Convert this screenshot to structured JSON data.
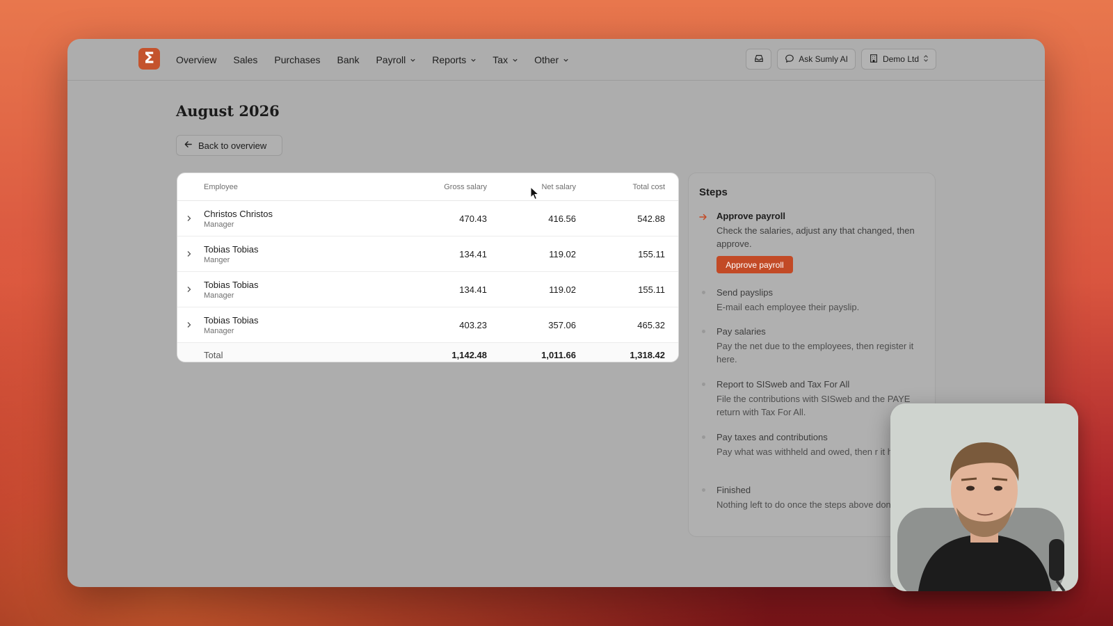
{
  "app": {
    "logo_glyph": "Σ",
    "accent": "#c4532d"
  },
  "nav": {
    "items": [
      {
        "label": "Overview",
        "dropdown": false
      },
      {
        "label": "Sales",
        "dropdown": false
      },
      {
        "label": "Purchases",
        "dropdown": false
      },
      {
        "label": "Bank",
        "dropdown": false
      },
      {
        "label": "Payroll",
        "dropdown": true
      },
      {
        "label": "Reports",
        "dropdown": true
      },
      {
        "label": "Tax",
        "dropdown": true
      },
      {
        "label": "Other",
        "dropdown": true
      }
    ]
  },
  "toolbar": {
    "ask_ai_label": "Ask Sumly AI",
    "company_label": "Demo Ltd"
  },
  "page": {
    "title": "August 2026",
    "back_label": "Back to overview"
  },
  "table": {
    "headers": {
      "employee": "Employee",
      "gross": "Gross salary",
      "net": "Net salary",
      "total": "Total cost"
    },
    "rows": [
      {
        "name": "Christos Christos",
        "role": "Manager",
        "gross": "470.43",
        "net": "416.56",
        "total": "542.88"
      },
      {
        "name": "Tobias Tobias",
        "role": "Manger",
        "gross": "134.41",
        "net": "119.02",
        "total": "155.11"
      },
      {
        "name": "Tobias Tobias",
        "role": "Manager",
        "gross": "134.41",
        "net": "119.02",
        "total": "155.11"
      },
      {
        "name": "Tobias Tobias",
        "role": "Manager",
        "gross": "403.23",
        "net": "357.06",
        "total": "465.32"
      }
    ],
    "totals": {
      "label": "Total",
      "gross": "1,142.48",
      "net": "1,011.66",
      "total": "1,318.42"
    }
  },
  "steps": {
    "title": "Steps",
    "items": [
      {
        "title": "Approve payroll",
        "desc": "Check the salaries, adjust any that changed, then approve.",
        "active": true,
        "button": "Approve payroll"
      },
      {
        "title": "Send payslips",
        "desc": "E-mail each employee their payslip.",
        "active": false
      },
      {
        "title": "Pay salaries",
        "desc": "Pay the net due to the employees, then register it here.",
        "active": false
      },
      {
        "title": "Report to SISweb and Tax For All",
        "desc": "File the contributions with SISweb and the PAYE return with Tax For All.",
        "active": false
      },
      {
        "title": "Pay taxes and contributions",
        "desc": "Pay what was withheld and owed, then r it here.",
        "active": false
      },
      {
        "title": "Finished",
        "desc": "Nothing left to do once the steps above done.",
        "active": false
      }
    ]
  }
}
